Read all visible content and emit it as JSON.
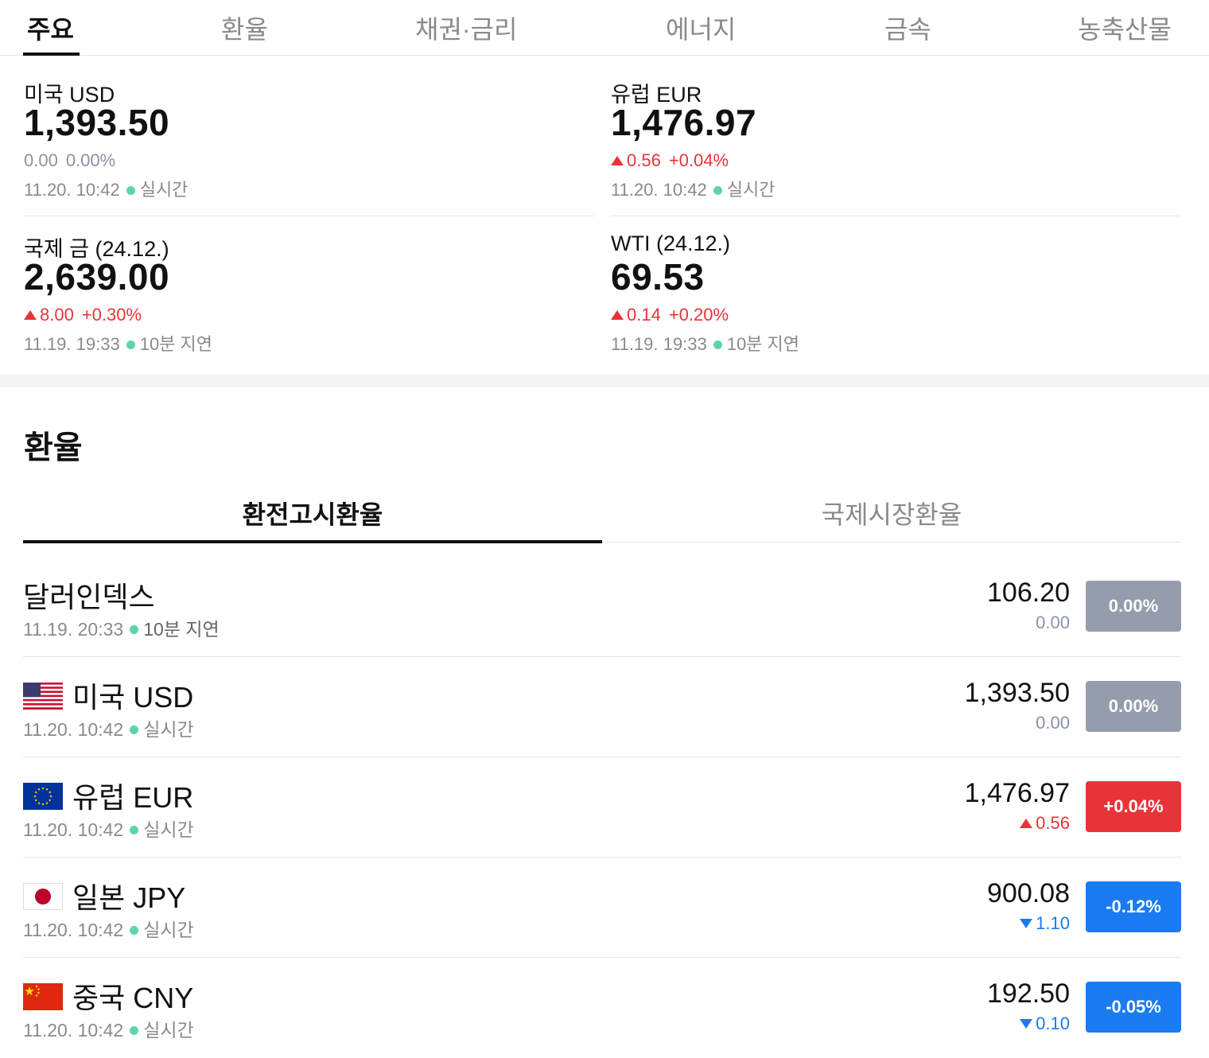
{
  "top_tabs": [
    {
      "label": "주요",
      "active": true
    },
    {
      "label": "환율",
      "active": false
    },
    {
      "label": "채권·금리",
      "active": false
    },
    {
      "label": "에너지",
      "active": false
    },
    {
      "label": "금속",
      "active": false
    },
    {
      "label": "농축산물",
      "active": false
    }
  ],
  "summary": [
    {
      "name": "미국 USD",
      "price": "1,393.50",
      "change": "0.00",
      "percent": "0.00%",
      "direction": "flat",
      "time": "11.20. 10:42",
      "status": "실시간"
    },
    {
      "name": "유럽 EUR",
      "price": "1,476.97",
      "change": "0.56",
      "percent": "+0.04%",
      "direction": "up",
      "time": "11.20. 10:42",
      "status": "실시간"
    },
    {
      "name": "국제 금 (24.12.)",
      "price": "2,639.00",
      "change": "8.00",
      "percent": "+0.30%",
      "direction": "up",
      "time": "11.19. 19:33",
      "status": "10분 지연"
    },
    {
      "name": "WTI (24.12.)",
      "price": "69.53",
      "change": "0.14",
      "percent": "+0.20%",
      "direction": "up",
      "time": "11.19. 19:33",
      "status": "10분 지연"
    }
  ],
  "section": {
    "title": "환율",
    "sub_tabs": [
      {
        "label": "환전고시환율",
        "active": true
      },
      {
        "label": "국제시장환율",
        "active": false
      }
    ]
  },
  "rates": [
    {
      "name": "달러인덱스",
      "flag": "none",
      "time": "11.19. 20:33",
      "status": "10분 지연",
      "price": "106.20",
      "change": "0.00",
      "direction": "flat",
      "percent": "0.00%"
    },
    {
      "name": "미국 USD",
      "flag": "us-flag-icon",
      "time": "11.20. 10:42",
      "status": "실시간",
      "price": "1,393.50",
      "change": "0.00",
      "direction": "flat",
      "percent": "0.00%"
    },
    {
      "name": "유럽 EUR",
      "flag": "eu-flag-icon",
      "time": "11.20. 10:42",
      "status": "실시간",
      "price": "1,476.97",
      "change": "0.56",
      "direction": "up",
      "percent": "+0.04%"
    },
    {
      "name": "일본 JPY",
      "flag": "jp-flag-icon",
      "time": "11.20. 10:42",
      "status": "실시간",
      "price": "900.08",
      "change": "1.10",
      "direction": "down",
      "percent": "-0.12%"
    },
    {
      "name": "중국 CNY",
      "flag": "cn-flag-icon",
      "time": "11.20. 10:42",
      "status": "실시간",
      "price": "192.50",
      "change": "0.10",
      "direction": "down",
      "percent": "-0.05%"
    }
  ],
  "colors": {
    "up": "#e83438",
    "down": "#1a7cf0",
    "flat_badge": "#959dad",
    "realtime_dot": "#5fd3b1"
  }
}
